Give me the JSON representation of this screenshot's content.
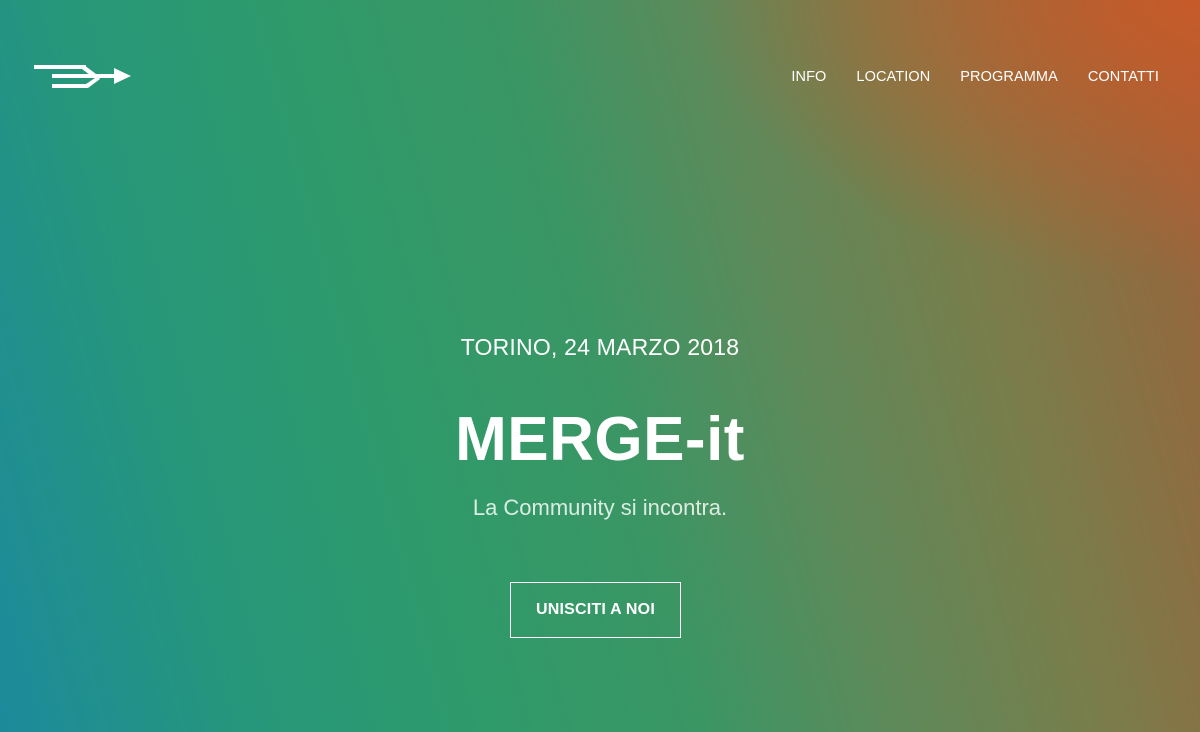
{
  "header": {
    "logo_icon": "merge-arrows-icon",
    "nav": [
      {
        "label": "INFO"
      },
      {
        "label": "LOCATION"
      },
      {
        "label": "PROGRAMMA"
      },
      {
        "label": "CONTATTI"
      }
    ]
  },
  "hero": {
    "dateline": "TORINO, 24 MARZO 2018",
    "title": "MERGE-it",
    "subtitle": "La Community si incontra.",
    "cta_label": "UNISCITI A NOI"
  },
  "colors": {
    "gradient_start": "#1d8a9c",
    "gradient_mid": "#2f9a6a",
    "gradient_end": "#b35a32",
    "text": "#ffffff"
  }
}
